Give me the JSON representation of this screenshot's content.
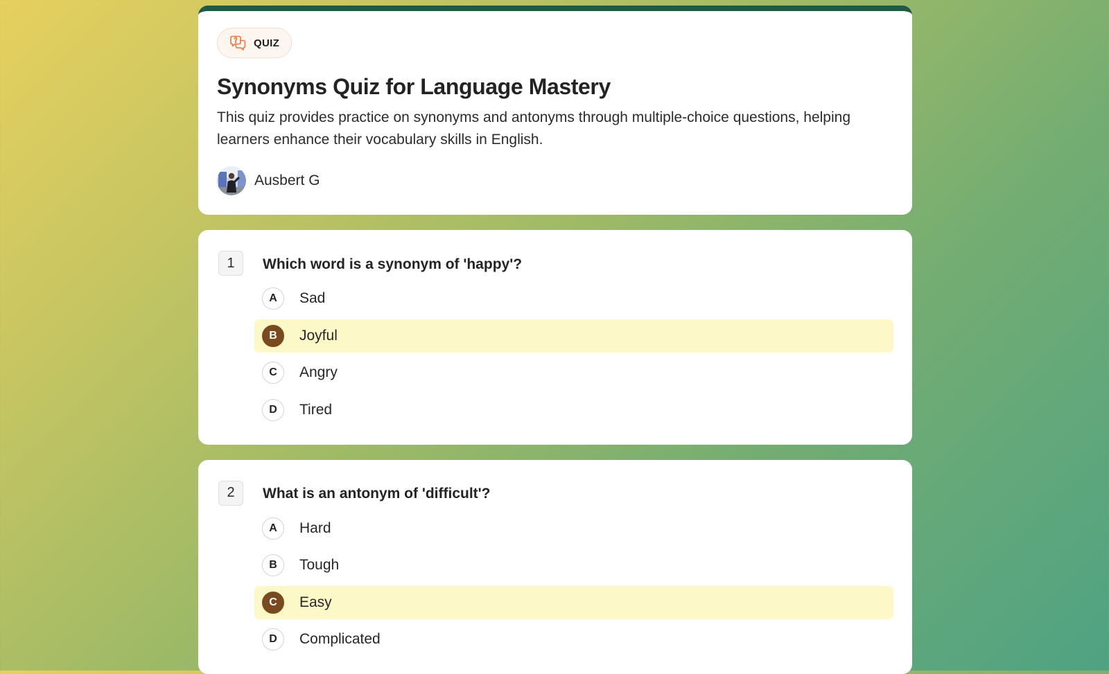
{
  "header": {
    "badge": "QUIZ",
    "badge_icon": "question-chat-icon",
    "title": "Synonyms Quiz for Language Mastery",
    "description": "This quiz provides practice on synonyms and antonyms through multiple-choice questions, helping learners enhance their vocabulary skills in English.",
    "author": "Ausbert G"
  },
  "colors": {
    "header_accent": "#1f5a45",
    "selected_bg": "#fdf8c8",
    "selected_letter": "#7a4a1f",
    "badge_icon": "#e07a3e"
  },
  "questions": [
    {
      "number": "1",
      "text": "Which word is a synonym of 'happy'?",
      "options": [
        {
          "letter": "A",
          "text": "Sad",
          "selected": false
        },
        {
          "letter": "B",
          "text": "Joyful",
          "selected": true
        },
        {
          "letter": "C",
          "text": "Angry",
          "selected": false
        },
        {
          "letter": "D",
          "text": "Tired",
          "selected": false
        }
      ]
    },
    {
      "number": "2",
      "text": "What is an antonym of 'difficult'?",
      "options": [
        {
          "letter": "A",
          "text": "Hard",
          "selected": false
        },
        {
          "letter": "B",
          "text": "Tough",
          "selected": false
        },
        {
          "letter": "C",
          "text": "Easy",
          "selected": true
        },
        {
          "letter": "D",
          "text": "Complicated",
          "selected": false
        }
      ]
    }
  ]
}
